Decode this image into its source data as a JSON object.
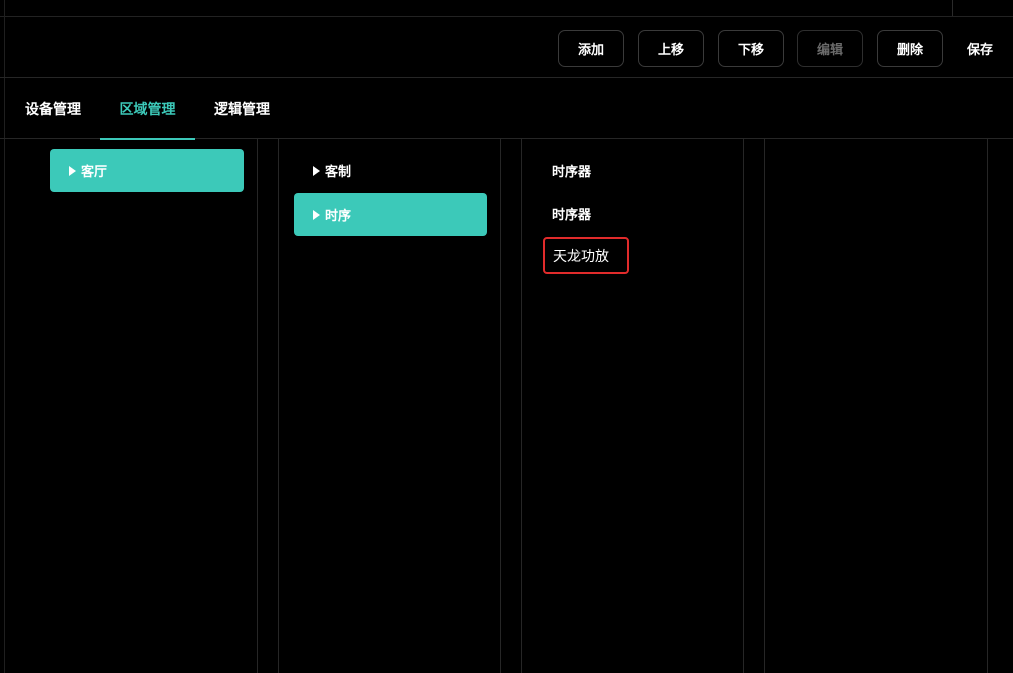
{
  "toolbar": {
    "add_label": "添加",
    "move_up_label": "上移",
    "move_down_label": "下移",
    "edit_label": "编辑",
    "delete_label": "删除",
    "save_label": "保存"
  },
  "tabs": [
    {
      "label": "设备管理",
      "active": false
    },
    {
      "label": "区域管理",
      "active": true
    },
    {
      "label": "逻辑管理",
      "active": false
    }
  ],
  "columns": {
    "col1": [
      {
        "label": "客厅",
        "selected": true
      }
    ],
    "col2": [
      {
        "label": "客制",
        "selected": false
      },
      {
        "label": "时序",
        "selected": true
      }
    ],
    "col3": [
      {
        "label": "时序器"
      },
      {
        "label": "时序器"
      },
      {
        "label": "天龙功放",
        "highlighted": true
      }
    ]
  },
  "colors": {
    "accent": "#3cc9b9",
    "highlight_border": "#e12b2b",
    "background": "#000000"
  }
}
